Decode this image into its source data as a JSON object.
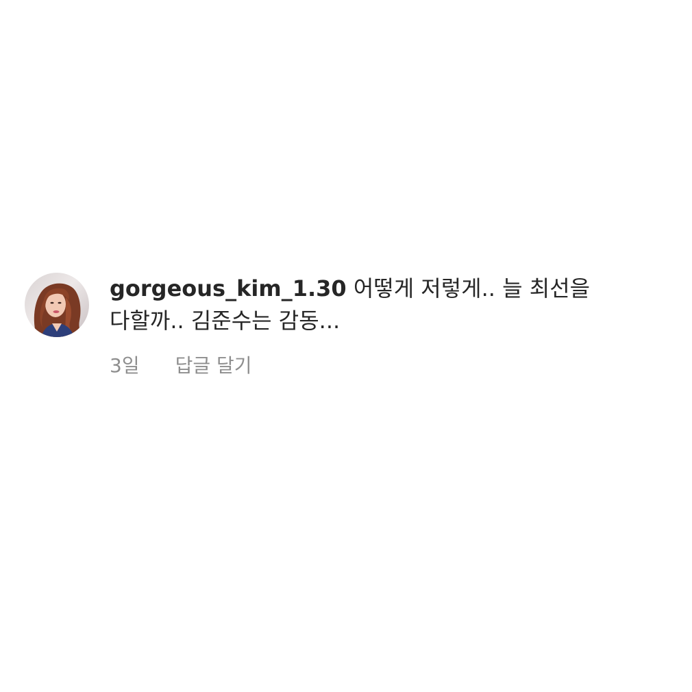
{
  "comment": {
    "avatar_icon": "profile-photo-avatar",
    "username": "gorgeous_kim_1.30",
    "text": "어떻게 저렇게.. 늘 최선을 다할까.. 김준수는 감동...",
    "timestamp": "3일",
    "reply_label": "답글 달기"
  },
  "colors": {
    "text_primary": "#262626",
    "text_secondary": "#8e8e8e",
    "background": "#ffffff"
  }
}
